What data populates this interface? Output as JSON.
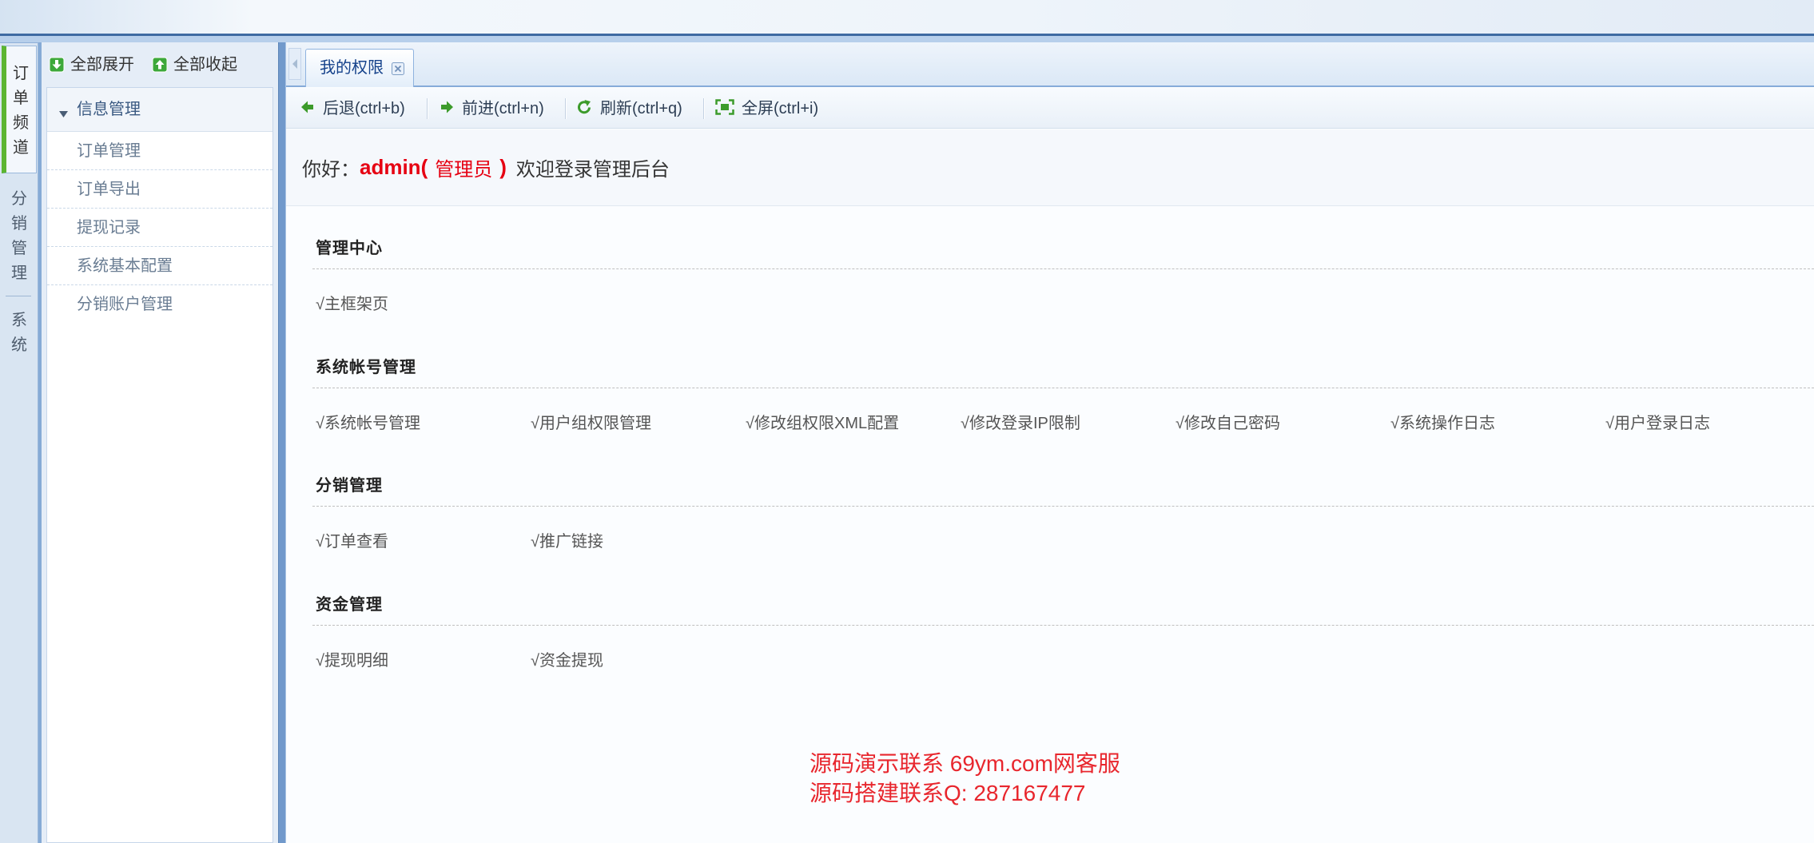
{
  "left_tabs": [
    {
      "label": "订单频道",
      "active": true
    },
    {
      "label": "分销管理",
      "active": false
    },
    {
      "label": "系统",
      "active": false
    }
  ],
  "sidebar": {
    "expand_all": "全部展开",
    "collapse_all": "全部收起",
    "group": {
      "label": "信息管理",
      "items": [
        "订单管理",
        "订单导出",
        "提现记录",
        "系统基本配置",
        "分销账户管理"
      ]
    }
  },
  "main": {
    "tabs": [
      {
        "label": "我的权限",
        "active": true
      }
    ],
    "toolbar": {
      "back": "后退(ctrl+b)",
      "forward": "前进(ctrl+n)",
      "refresh": "刷新(ctrl+q)",
      "fullscreen": "全屏(ctrl+i)"
    },
    "welcome": {
      "greeting": "你好：",
      "user": "admin(",
      "role": "管理员",
      "user_close": ")",
      "message": "欢迎登录管理后台"
    },
    "permission_sections": [
      {
        "title": "管理中心",
        "items": [
          "√主框架页"
        ]
      },
      {
        "title": "系统帐号管理",
        "items": [
          "√系统帐号管理",
          "√用户组权限管理",
          "√修改组权限XML配置",
          "√修改登录IP限制",
          "√修改自己密码",
          "√系统操作日志",
          "√用户登录日志"
        ]
      },
      {
        "title": "分销管理",
        "items": [
          "√订单查看",
          "√推广链接"
        ]
      },
      {
        "title": "资金管理",
        "items": [
          "√提现明细",
          "√资金提现"
        ]
      }
    ]
  },
  "watermark": [
    "源码演示联系 69ym.com网客服",
    "源码搭建联系Q: 287167477"
  ],
  "icons": {
    "expand_all": "expand-down-icon",
    "collapse_all": "collapse-up-icon",
    "group_toggle": "caret-down-icon",
    "panel_toggle": "collapse-left-icon",
    "tab_close": "close-icon",
    "back": "arrow-left-icon",
    "forward": "arrow-right-icon",
    "refresh": "refresh-icon",
    "fullscreen": "fullscreen-icon"
  },
  "colors": {
    "accent_green": "#5cb531",
    "icon_green": "#3c9b2b",
    "frame_blue": "#7199cb",
    "highlight_red": "#e60012",
    "watermark_red": "#e8262d"
  }
}
